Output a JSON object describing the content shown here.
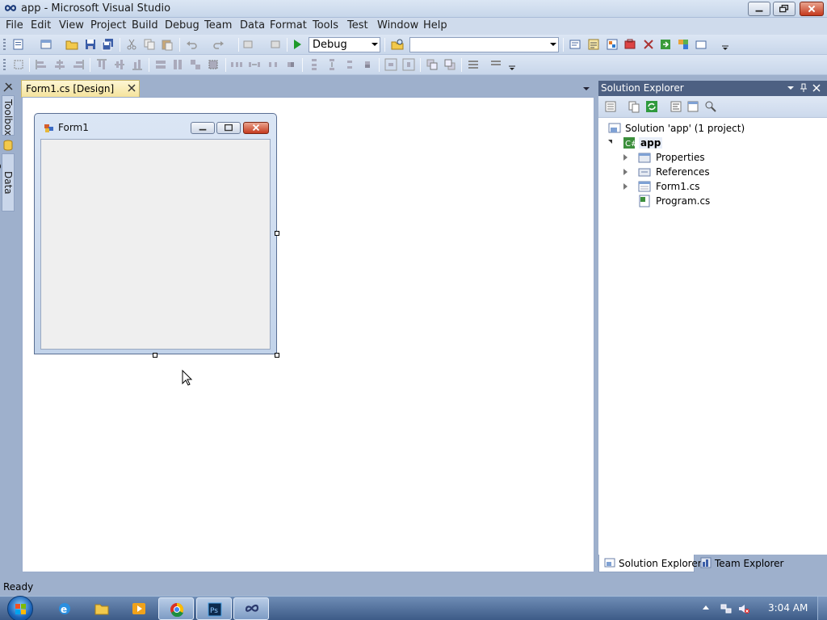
{
  "window": {
    "title": "app - Microsoft Visual Studio"
  },
  "menubar": {
    "items": [
      "File",
      "Edit",
      "View",
      "Project",
      "Build",
      "Debug",
      "Team",
      "Data",
      "Format",
      "Tools",
      "Test",
      "Window",
      "Help"
    ]
  },
  "toolbar": {
    "configuration": "Debug",
    "platform": ""
  },
  "side_tabs": {
    "toolbox": "Toolbox",
    "data_sources": "Data Sources"
  },
  "document_tab": {
    "label": "Form1.cs [Design]"
  },
  "designer": {
    "form_caption": "Form1"
  },
  "solution_explorer": {
    "title": "Solution Explorer",
    "tree": {
      "solution": "Solution 'app' (1 project)",
      "project": "app",
      "items": [
        "Properties",
        "References",
        "Form1.cs",
        "Program.cs"
      ]
    },
    "bottom_tabs": [
      "Solution Explorer",
      "Team Explorer"
    ]
  },
  "status": {
    "text": "Ready"
  },
  "taskbar": {
    "clock": "3:04 AM"
  },
  "colors": {
    "chrome_bg": "#9eb0cc",
    "panel_header": "#4d6082",
    "active_doc_tab": "#f4e29a",
    "form_client": "#efefef",
    "taskbar": "#3d5b87"
  }
}
